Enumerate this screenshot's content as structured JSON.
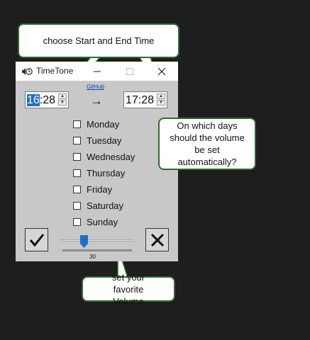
{
  "window": {
    "title": "TimeTone",
    "icon": "speaker-clock-icon",
    "minimize_icon": "minimize-icon",
    "maximize_icon": "maximize-icon",
    "close_icon": "close-icon"
  },
  "start_time": {
    "hour": "16",
    "rest": ":28"
  },
  "end_time": {
    "value": "17:28"
  },
  "github_link": "GitHub",
  "arrow": "→",
  "days": [
    "Monday",
    "Tuesday",
    "Wednesday",
    "Thursday",
    "Friday",
    "Saturday",
    "Sunday"
  ],
  "volume": {
    "value": "30",
    "level": 30,
    "max": 100
  },
  "buttons": {
    "confirm_icon": "checkmark-icon",
    "cancel_icon": "x-icon"
  },
  "callouts": {
    "time": "choose Start and End Time",
    "days": "On which days should the volume be set automatically?",
    "volume": "set your favorite Volume"
  },
  "colors": {
    "selection": "#1f6fc9",
    "slider_thumb": "#1f6fc9",
    "callout_border": "#2f6b2f",
    "background": "#1e1e1e"
  }
}
